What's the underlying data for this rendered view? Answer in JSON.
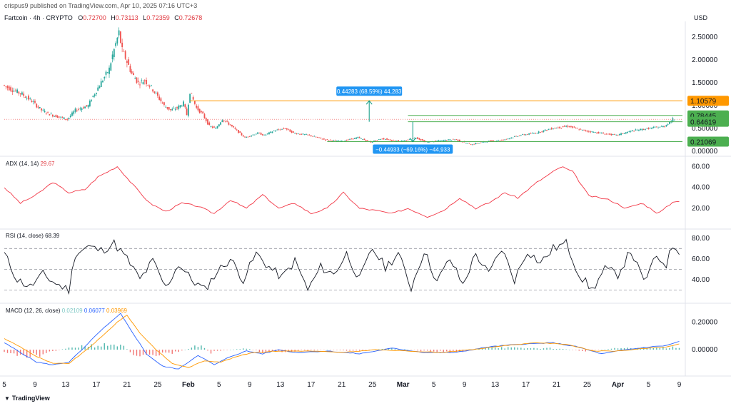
{
  "header": {
    "published": "crispus9 published on TradingView.com, Apr 10, 2025 07:16 UTC+3",
    "symbol": "Fartcoin · 4h · CRYPTO",
    "o_label": "O",
    "o_value": "0.72700",
    "h_label": "H",
    "h_value": "0.73113",
    "l_label": "L",
    "l_value": "0.72359",
    "c_label": "C",
    "c_value": "0.72678",
    "currency": "USD"
  },
  "brand": {
    "name": "TradingView",
    "logo_icon": "tradingview-logo-icon"
  },
  "colors": {
    "up": "#26a69a",
    "down": "#ef5350",
    "adx": "#f23645",
    "rsi": "#131722",
    "macd": "#2962ff",
    "signal": "#ff9800",
    "level_orange": "#ff9800",
    "level_green": "#4caf50",
    "measure_blue": "#2196f3",
    "measure_green": "#089981"
  },
  "chart_data": [
    {
      "type": "candlestick",
      "name": "price",
      "x_ticks": [
        "5",
        "9",
        "13",
        "17",
        "21",
        "25",
        "Feb",
        "5",
        "9",
        "13",
        "17",
        "21",
        "25",
        "Mar",
        "5",
        "9",
        "13",
        "17",
        "21",
        "25",
        "Apr",
        "5",
        "9"
      ],
      "y_ticks": [
        "2.50000",
        "2.00000",
        "1.50000",
        "1.00000",
        "0.50000",
        "0.00000"
      ],
      "ylim": [
        0,
        2.75
      ],
      "path": [
        [
          0,
          1.45
        ],
        [
          6,
          1.35
        ],
        [
          12,
          1.25
        ],
        [
          18,
          1.1
        ],
        [
          24,
          0.9
        ],
        [
          30,
          0.8
        ],
        [
          40,
          0.7
        ],
        [
          45,
          0.9
        ],
        [
          53,
          1.0
        ],
        [
          55,
          1.15
        ],
        [
          60,
          1.45
        ],
        [
          66,
          1.8
        ],
        [
          68,
          2.1
        ],
        [
          72,
          2.6
        ],
        [
          74,
          2.2
        ],
        [
          76,
          2.05
        ],
        [
          80,
          1.7
        ],
        [
          84,
          1.5
        ],
        [
          88,
          1.55
        ],
        [
          92,
          1.4
        ],
        [
          96,
          1.2
        ],
        [
          100,
          1.0
        ],
        [
          104,
          0.9
        ],
        [
          108,
          0.95
        ],
        [
          112,
          1.05
        ],
        [
          114,
          0.8
        ],
        [
          116,
          1.3
        ],
        [
          120,
          0.95
        ],
        [
          124,
          0.8
        ],
        [
          128,
          0.55
        ],
        [
          132,
          0.5
        ],
        [
          136,
          0.7
        ],
        [
          140,
          0.6
        ],
        [
          150,
          0.3
        ],
        [
          158,
          0.4
        ],
        [
          162,
          0.35
        ],
        [
          168,
          0.45
        ],
        [
          175,
          0.5
        ],
        [
          180,
          0.4
        ],
        [
          190,
          0.35
        ],
        [
          200,
          0.25
        ],
        [
          210,
          0.22
        ],
        [
          220,
          0.3
        ],
        [
          228,
          0.2
        ],
        [
          235,
          0.28
        ],
        [
          240,
          0.25
        ],
        [
          248,
          0.22
        ],
        [
          256,
          0.3
        ],
        [
          262,
          0.2
        ],
        [
          270,
          0.23
        ],
        [
          280,
          0.26
        ],
        [
          290,
          0.15
        ],
        [
          300,
          0.22
        ],
        [
          310,
          0.25
        ],
        [
          320,
          0.35
        ],
        [
          330,
          0.4
        ],
        [
          340,
          0.5
        ],
        [
          350,
          0.55
        ],
        [
          360,
          0.45
        ],
        [
          370,
          0.4
        ],
        [
          380,
          0.35
        ],
        [
          390,
          0.45
        ],
        [
          400,
          0.5
        ],
        [
          410,
          0.55
        ],
        [
          415,
          0.7
        ]
      ],
      "levels": [
        {
          "label": "1.10579",
          "value": 1.10579,
          "color": "level_orange"
        },
        {
          "label": "0.78445",
          "value": 0.78445,
          "color": "level_green"
        },
        {
          "label": "0.64619",
          "value": 0.64619,
          "color": "level_green"
        },
        {
          "label": "0.21069",
          "value": 0.21069,
          "color": "level_green"
        }
      ],
      "measures": [
        {
          "label": "0.44283 (68.59%) 44,283",
          "from": 0.64619,
          "to": 1.10579,
          "direction": "up"
        },
        {
          "label": "−0.44933 (−69.16%) −44,933",
          "from": 0.64619,
          "to": 0.21069,
          "direction": "down"
        }
      ]
    },
    {
      "type": "line",
      "name": "ADX",
      "title": "ADX (14, 14)",
      "last_value": "29.67",
      "y_ticks": [
        "60.00",
        "40.00",
        "20.00"
      ],
      "ylim": [
        5,
        65
      ],
      "path": [
        [
          0,
          40
        ],
        [
          10,
          25
        ],
        [
          20,
          33
        ],
        [
          30,
          45
        ],
        [
          40,
          35
        ],
        [
          50,
          38
        ],
        [
          58,
          50
        ],
        [
          70,
          60
        ],
        [
          80,
          42
        ],
        [
          90,
          25
        ],
        [
          100,
          17
        ],
        [
          110,
          25
        ],
        [
          120,
          22
        ],
        [
          130,
          15
        ],
        [
          140,
          28
        ],
        [
          150,
          20
        ],
        [
          160,
          33
        ],
        [
          170,
          20
        ],
        [
          180,
          25
        ],
        [
          190,
          15
        ],
        [
          200,
          20
        ],
        [
          210,
          35
        ],
        [
          220,
          20
        ],
        [
          230,
          18
        ],
        [
          240,
          15
        ],
        [
          250,
          20
        ],
        [
          262,
          12
        ],
        [
          272,
          18
        ],
        [
          282,
          30
        ],
        [
          292,
          20
        ],
        [
          300,
          25
        ],
        [
          310,
          35
        ],
        [
          318,
          30
        ],
        [
          330,
          45
        ],
        [
          345,
          60
        ],
        [
          352,
          55
        ],
        [
          362,
          32
        ],
        [
          375,
          28
        ],
        [
          385,
          20
        ],
        [
          395,
          25
        ],
        [
          405,
          15
        ],
        [
          415,
          27
        ]
      ]
    },
    {
      "type": "line",
      "name": "RSI",
      "title": "RSI (14, close)",
      "last_value": "68.39",
      "y_ticks": [
        "80.00",
        "60.00",
        "40.00"
      ],
      "ylim": [
        22,
        84
      ],
      "guides": [
        70,
        50,
        30
      ],
      "path": [
        [
          0,
          65
        ],
        [
          8,
          40
        ],
        [
          16,
          33
        ],
        [
          24,
          45
        ],
        [
          32,
          36
        ],
        [
          40,
          30
        ],
        [
          44,
          65
        ],
        [
          52,
          72
        ],
        [
          60,
          68
        ],
        [
          68,
          75
        ],
        [
          76,
          60
        ],
        [
          84,
          40
        ],
        [
          92,
          58
        ],
        [
          100,
          32
        ],
        [
          108,
          55
        ],
        [
          116,
          40
        ],
        [
          124,
          30
        ],
        [
          132,
          48
        ],
        [
          140,
          60
        ],
        [
          148,
          40
        ],
        [
          156,
          65
        ],
        [
          164,
          52
        ],
        [
          172,
          42
        ],
        [
          180,
          58
        ],
        [
          188,
          30
        ],
        [
          196,
          52
        ],
        [
          204,
          45
        ],
        [
          212,
          65
        ],
        [
          220,
          40
        ],
        [
          228,
          70
        ],
        [
          236,
          52
        ],
        [
          244,
          65
        ],
        [
          252,
          32
        ],
        [
          260,
          68
        ],
        [
          268,
          38
        ],
        [
          276,
          60
        ],
        [
          284,
          35
        ],
        [
          292,
          65
        ],
        [
          300,
          45
        ],
        [
          308,
          70
        ],
        [
          316,
          40
        ],
        [
          324,
          68
        ],
        [
          332,
          56
        ],
        [
          340,
          70
        ],
        [
          348,
          75
        ],
        [
          356,
          45
        ],
        [
          364,
          30
        ],
        [
          372,
          50
        ],
        [
          380,
          45
        ],
        [
          388,
          68
        ],
        [
          396,
          38
        ],
        [
          404,
          62
        ],
        [
          410,
          55
        ],
        [
          414,
          73
        ],
        [
          418,
          68
        ]
      ]
    },
    {
      "type": "line+histogram",
      "name": "MACD",
      "title": "MACD (12, 26, close)",
      "macd_value": "0.02109",
      "signal_value": "0.06077",
      "hist_value": "0.03969",
      "y_ticks": [
        "0.20000",
        "0.00000"
      ],
      "ylim": [
        -0.16,
        0.3
      ],
      "macd_path": [
        [
          0,
          0.05
        ],
        [
          10,
          -0.02
        ],
        [
          20,
          -0.09
        ],
        [
          30,
          -0.11
        ],
        [
          40,
          -0.09
        ],
        [
          50,
          0.02
        ],
        [
          58,
          0.12
        ],
        [
          66,
          0.2
        ],
        [
          72,
          0.26
        ],
        [
          78,
          0.15
        ],
        [
          88,
          -0.03
        ],
        [
          98,
          -0.12
        ],
        [
          108,
          -0.14
        ],
        [
          120,
          -0.04
        ],
        [
          130,
          -0.11
        ],
        [
          140,
          -0.05
        ],
        [
          150,
          -0.01
        ],
        [
          160,
          -0.03
        ],
        [
          170,
          0.0
        ],
        [
          180,
          -0.02
        ],
        [
          200,
          -0.01
        ],
        [
          220,
          -0.03
        ],
        [
          240,
          0.01
        ],
        [
          260,
          -0.02
        ],
        [
          280,
          -0.02
        ],
        [
          300,
          0.02
        ],
        [
          320,
          0.04
        ],
        [
          340,
          0.05
        ],
        [
          355,
          0.02
        ],
        [
          370,
          -0.03
        ],
        [
          385,
          0.0
        ],
        [
          400,
          0.02
        ],
        [
          410,
          0.03
        ],
        [
          418,
          0.06
        ]
      ],
      "signal_path": [
        [
          0,
          0.08
        ],
        [
          10,
          0.02
        ],
        [
          20,
          -0.05
        ],
        [
          30,
          -0.1
        ],
        [
          40,
          -0.1
        ],
        [
          50,
          -0.01
        ],
        [
          60,
          0.09
        ],
        [
          70,
          0.2
        ],
        [
          76,
          0.25
        ],
        [
          84,
          0.12
        ],
        [
          94,
          0.0
        ],
        [
          104,
          -0.1
        ],
        [
          114,
          -0.13
        ],
        [
          124,
          -0.08
        ],
        [
          134,
          -0.09
        ],
        [
          144,
          -0.05
        ],
        [
          154,
          -0.02
        ],
        [
          170,
          -0.01
        ],
        [
          190,
          -0.01
        ],
        [
          210,
          -0.02
        ],
        [
          230,
          0.0
        ],
        [
          250,
          -0.01
        ],
        [
          270,
          -0.02
        ],
        [
          290,
          0.0
        ],
        [
          310,
          0.03
        ],
        [
          330,
          0.05
        ],
        [
          348,
          0.04
        ],
        [
          365,
          -0.01
        ],
        [
          380,
          -0.01
        ],
        [
          398,
          0.01
        ],
        [
          410,
          0.02
        ],
        [
          418,
          0.04
        ]
      ],
      "hist_path": [
        [
          0,
          -0.03
        ],
        [
          10,
          -0.04
        ],
        [
          20,
          -0.04
        ],
        [
          30,
          -0.01
        ],
        [
          40,
          0.01
        ],
        [
          50,
          0.03
        ],
        [
          60,
          0.03
        ],
        [
          68,
          0.04
        ],
        [
          74,
          0.02
        ],
        [
          80,
          -0.03
        ],
        [
          90,
          -0.04
        ],
        [
          100,
          -0.03
        ],
        [
          110,
          -0.01
        ],
        [
          120,
          0.04
        ],
        [
          128,
          -0.02
        ],
        [
          140,
          0.0
        ],
        [
          150,
          0.01
        ],
        [
          160,
          -0.02
        ],
        [
          180,
          -0.01
        ],
        [
          200,
          0.0
        ],
        [
          220,
          -0.01
        ],
        [
          240,
          0.01
        ],
        [
          260,
          -0.01
        ],
        [
          280,
          -0.02
        ],
        [
          300,
          0.02
        ],
        [
          320,
          0.01
        ],
        [
          340,
          0.01
        ],
        [
          360,
          -0.01
        ],
        [
          380,
          0.01
        ],
        [
          400,
          0.01
        ],
        [
          418,
          0.02
        ]
      ]
    }
  ]
}
